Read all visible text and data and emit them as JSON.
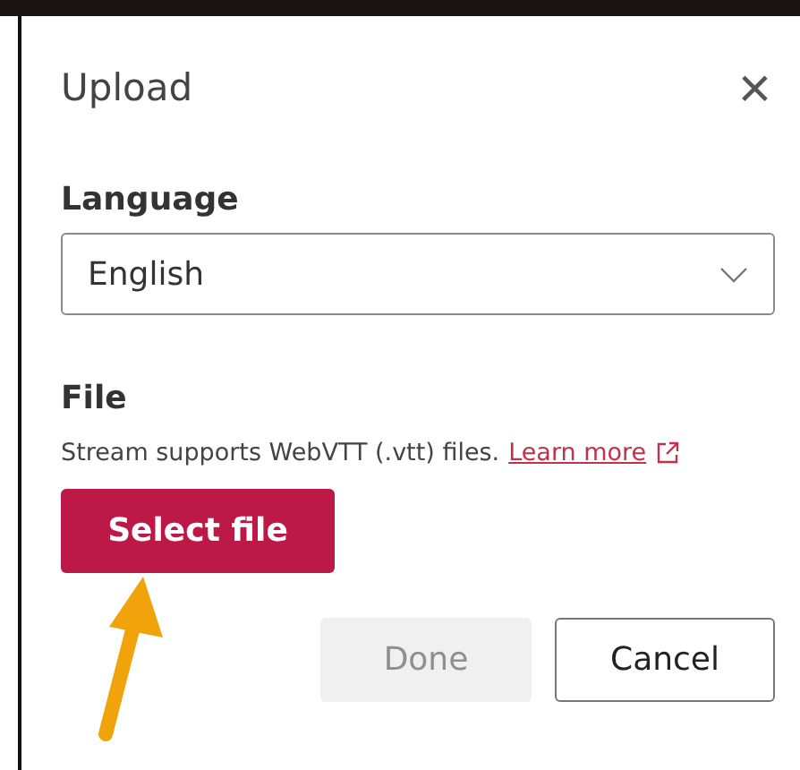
{
  "dialog": {
    "title": "Upload",
    "close": "×"
  },
  "language": {
    "label": "Language",
    "value": "English"
  },
  "file": {
    "label": "File",
    "description": "Stream supports WebVTT (.vtt) files.",
    "link": "Learn more",
    "button": "Select file"
  },
  "buttons": [
    {
      "label": "Done",
      "disabled": true
    },
    {
      "label": "Cancel",
      "disabled": false
    }
  ]
}
